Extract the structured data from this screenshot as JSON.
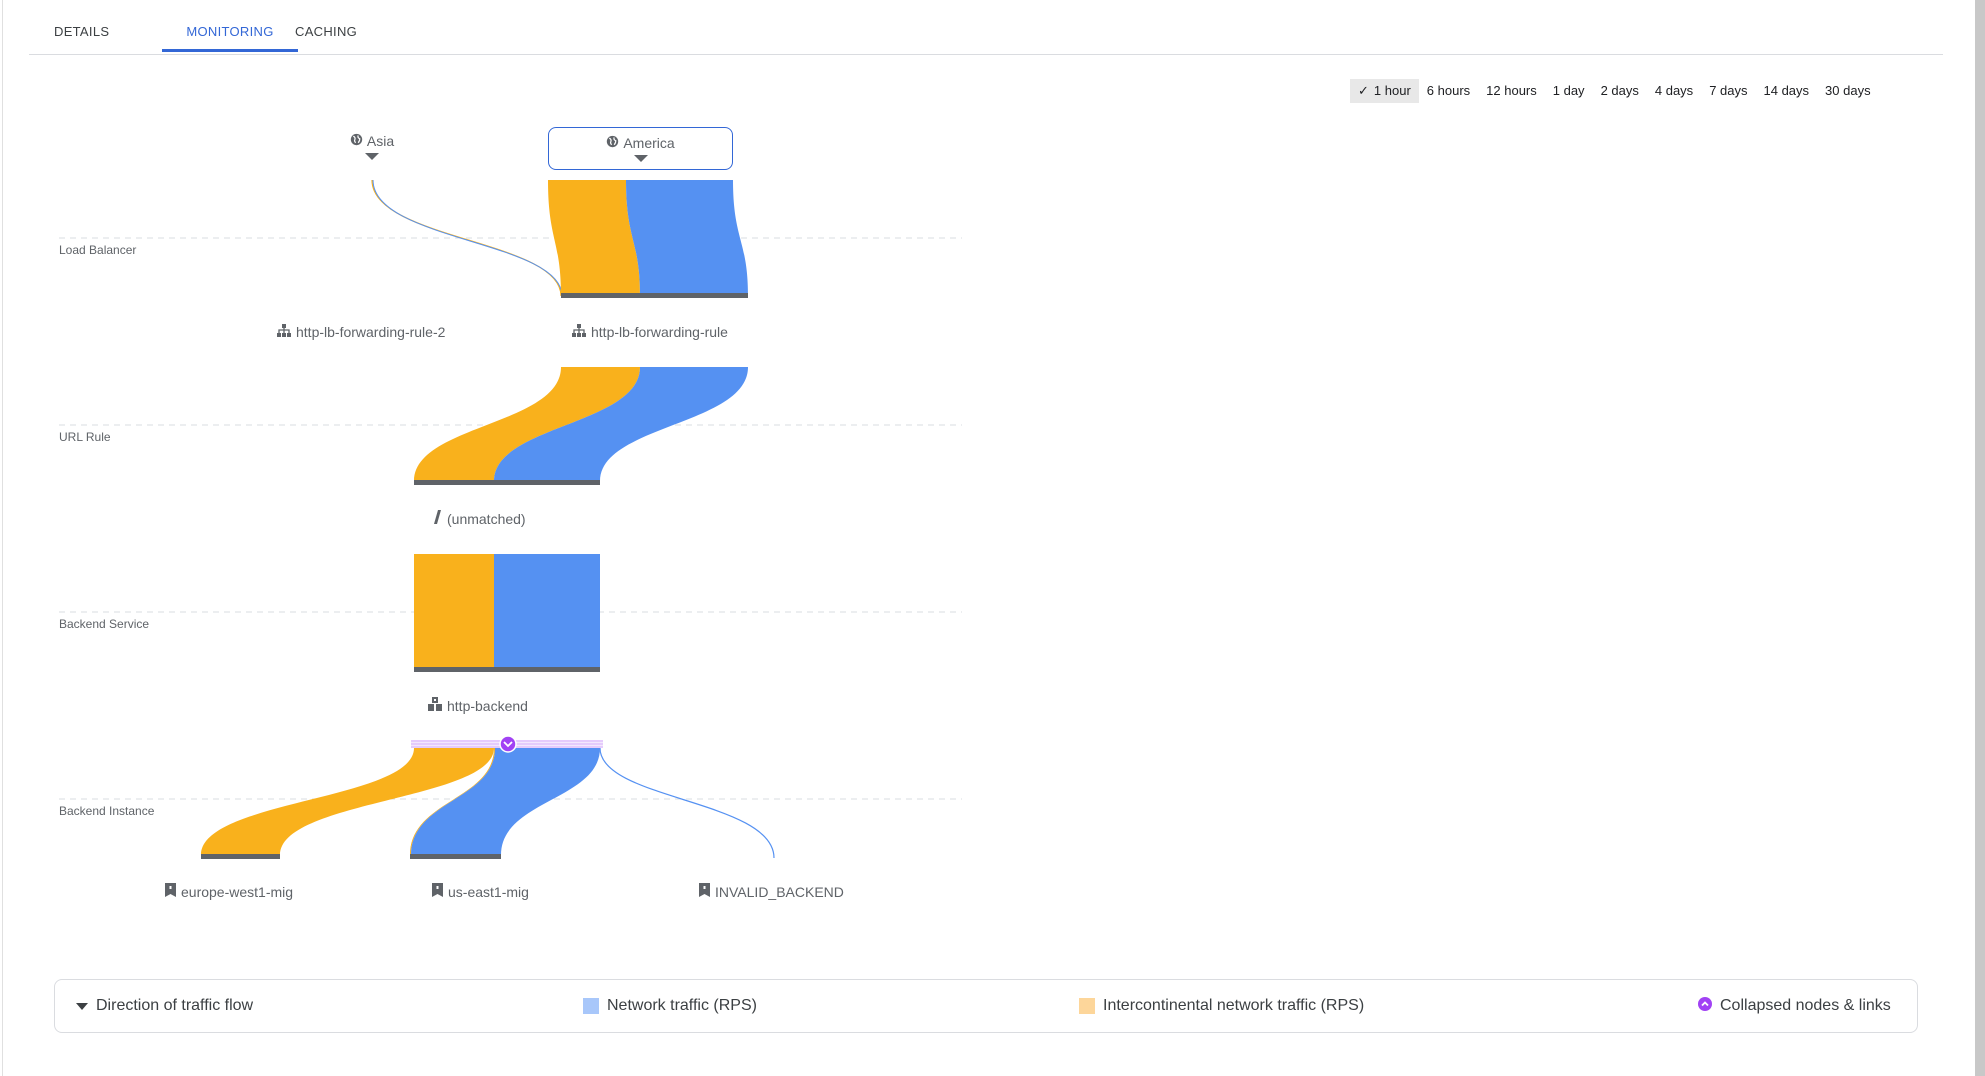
{
  "tabs": [
    {
      "label": "DETAILS",
      "active": false
    },
    {
      "label": "MONITORING",
      "active": true
    },
    {
      "label": "CACHING",
      "active": false
    }
  ],
  "time_ranges": {
    "selected": "1 hour",
    "options": [
      "1 hour",
      "6 hours",
      "12 hours",
      "1 day",
      "2 days",
      "4 days",
      "7 days",
      "14 days",
      "30 days"
    ]
  },
  "colors": {
    "network": "#5591f2",
    "intercontinental": "#f9b11c",
    "node_bar": "#5f6368",
    "collapsed": "#a142f4",
    "legend_network": "#a8c7fa",
    "legend_intercontinental": "#fdd69a",
    "accent": "#3367d6"
  },
  "lanes": [
    {
      "label": "Load Balancer"
    },
    {
      "label": "URL Rule"
    },
    {
      "label": "Backend Service"
    },
    {
      "label": "Backend Instance"
    }
  ],
  "regions": [
    {
      "label": "Asia",
      "icon": "globe-icon",
      "selected": false
    },
    {
      "label": "America",
      "icon": "globe-icon",
      "selected": true
    }
  ],
  "nodes": {
    "load_balancers": [
      {
        "label": "http-lb-forwarding-rule-2",
        "icon": "load-balancer-icon"
      },
      {
        "label": "http-lb-forwarding-rule",
        "icon": "load-balancer-icon"
      }
    ],
    "url_rules": [
      {
        "label": "(unmatched)",
        "icon": "url-rule-icon"
      }
    ],
    "backend_services": [
      {
        "label": "http-backend",
        "icon": "backend-service-icon"
      }
    ],
    "backend_instances": [
      {
        "label": "europe-west1-mig",
        "icon": "instance-group-icon"
      },
      {
        "label": "us-east1-mig",
        "icon": "instance-group-icon"
      },
      {
        "label": "INVALID_BACKEND",
        "icon": "instance-group-icon"
      }
    ]
  },
  "legend": {
    "direction_label": "Direction of traffic flow",
    "network_label": "Network traffic (RPS)",
    "intercontinental_label": "Intercontinental network traffic (RPS)",
    "collapsed_label": "Collapsed nodes & links"
  }
}
